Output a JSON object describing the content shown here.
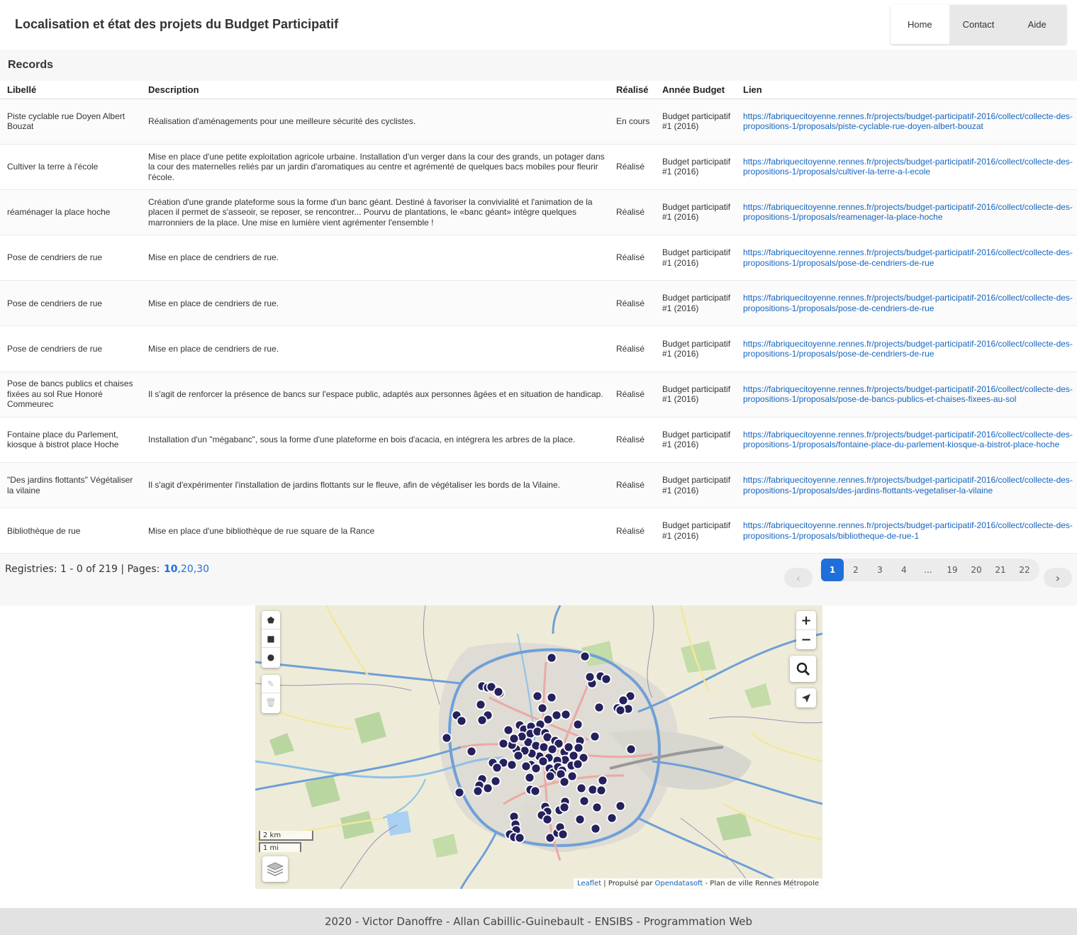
{
  "header": {
    "title": "Localisation et état des projets du Budget Participatif",
    "nav": [
      {
        "label": "Home",
        "active": true
      },
      {
        "label": "Contact",
        "active": false
      },
      {
        "label": "Aide",
        "active": false
      }
    ]
  },
  "records": {
    "title": "Records",
    "columns": [
      "Libellé",
      "Description",
      "Réalisé",
      "Année Budget",
      "Lien"
    ],
    "rows": [
      {
        "libelle": "Piste cyclable rue Doyen Albert Bouzat",
        "description": "Réalisation d'aménagements pour une meilleure sécurité des cyclistes.",
        "realise": "En cours",
        "annee": "Budget participatif #1 (2016)",
        "lien": "https://fabriquecitoyenne.rennes.fr/projects/budget-participatif-2016/collect/collecte-des-propositions-1/proposals/piste-cyclable-rue-doyen-albert-bouzat"
      },
      {
        "libelle": "Cultiver la terre à l'école",
        "description": "Mise en place d'une petite exploitation agricole urbaine. Installation d'un verger dans la cour des grands, un potager dans la cour des maternelles reliés par un jardin d'aromatiques au centre et agrémenté de quelques bacs mobiles pour fleurir l'école.",
        "realise": "Réalisé",
        "annee": "Budget participatif #1 (2016)",
        "lien": "https://fabriquecitoyenne.rennes.fr/projects/budget-participatif-2016/collect/collecte-des-propositions-1/proposals/cultiver-la-terre-a-l-ecole"
      },
      {
        "libelle": "réaménager la place hoche",
        "description": "Création d'une grande plateforme sous la forme d'un banc géant. Destiné à favoriser la convivialité et l'animation de la placen il permet de s'asseoir, se reposer, se rencontrer... Pourvu de plantations, le «banc géant» intègre quelques marronniers de la place. Une mise en lumière vient agrémenter l'ensemble !",
        "realise": "Réalisé",
        "annee": "Budget participatif #1 (2016)",
        "lien": "https://fabriquecitoyenne.rennes.fr/projects/budget-participatif-2016/collect/collecte-des-propositions-1/proposals/reamenager-la-place-hoche"
      },
      {
        "libelle": "Pose de cendriers de rue",
        "description": "Mise en place de cendriers de rue.",
        "realise": "Réalisé",
        "annee": "Budget participatif #1 (2016)",
        "lien": "https://fabriquecitoyenne.rennes.fr/projects/budget-participatif-2016/collect/collecte-des-propositions-1/proposals/pose-de-cendriers-de-rue"
      },
      {
        "libelle": "Pose de cendriers de rue",
        "description": "Mise en place de cendriers de rue.",
        "realise": "Réalisé",
        "annee": "Budget participatif #1 (2016)",
        "lien": "https://fabriquecitoyenne.rennes.fr/projects/budget-participatif-2016/collect/collecte-des-propositions-1/proposals/pose-de-cendriers-de-rue"
      },
      {
        "libelle": "Pose de cendriers de rue",
        "description": "Mise en place de cendriers de rue.",
        "realise": "Réalisé",
        "annee": "Budget participatif #1 (2016)",
        "lien": "https://fabriquecitoyenne.rennes.fr/projects/budget-participatif-2016/collect/collecte-des-propositions-1/proposals/pose-de-cendriers-de-rue"
      },
      {
        "libelle": "Pose de bancs publics et chaises fixées au sol Rue Honoré Commeurec",
        "description": "Il s'agit de renforcer la présence de bancs sur l'espace public, adaptés aux personnes âgées et en situation de handicap.",
        "realise": "Réalisé",
        "annee": "Budget participatif #1 (2016)",
        "lien": "https://fabriquecitoyenne.rennes.fr/projects/budget-participatif-2016/collect/collecte-des-propositions-1/proposals/pose-de-bancs-publics-et-chaises-fixees-au-sol"
      },
      {
        "libelle": "Fontaine place du Parlement, kiosque à bistrot place Hoche",
        "description": "Installation d'un \"mégabanc\", sous la forme d'une plateforme en bois d'acacia, en intégrera les arbres de la place.",
        "realise": "Réalisé",
        "annee": "Budget participatif #1 (2016)",
        "lien": "https://fabriquecitoyenne.rennes.fr/projects/budget-participatif-2016/collect/collecte-des-propositions-1/proposals/fontaine-place-du-parlement-kiosque-a-bistrot-place-hoche"
      },
      {
        "libelle": "\"Des jardins flottants\" Végétaliser la vilaine",
        "description": "Il s'agit d'expérimenter l'installation de jardins flottants sur le fleuve, afin de végétaliser les bords de la Vilaine.",
        "realise": "Réalisé",
        "annee": "Budget participatif #1 (2016)",
        "lien": "https://fabriquecitoyenne.rennes.fr/projects/budget-participatif-2016/collect/collecte-des-propositions-1/proposals/des-jardins-flottants-vegetaliser-la-vilaine"
      },
      {
        "libelle": "Bibliothèque de rue",
        "description": "Mise en place d'une bibliothèque de rue square de la Rance",
        "realise": "Réalisé",
        "annee": "Budget participatif #1 (2016)",
        "lien": "https://fabriquecitoyenne.rennes.fr/projects/budget-participatif-2016/collect/collecte-des-propositions-1/proposals/bibliotheque-de-rue-1"
      }
    ]
  },
  "pagination": {
    "info": "Registries: 1 - 0 of 219 | Pages:",
    "sizes": [
      "10",
      ",20",
      ",30"
    ],
    "selected_size": "10",
    "prev": "‹",
    "next": "›",
    "pages": [
      "1",
      "2",
      "3",
      "4",
      "...",
      "19",
      "20",
      "21",
      "22"
    ],
    "current": "1"
  },
  "map": {
    "zoom_in": "+",
    "zoom_out": "−",
    "scale_km": "2 km",
    "scale_mi": "1 mi",
    "attribution_leaflet": "Leaflet",
    "attribution_mid": " | Propulsé par ",
    "attribution_ods": "Opendatasoft",
    "attribution_end": " - Plan de ville Rennes Métropole",
    "marker_color": "#24215c",
    "icons": [
      "polygon-icon",
      "rectangle-icon",
      "circle-icon",
      "edit-icon",
      "trash-icon",
      "search-icon",
      "locate-icon",
      "layers-icon"
    ]
  },
  "footer": {
    "text": "2020 - Victor Danoffre - Allan Cabillic-Guinebault - ENSIBS - Programmation Web"
  }
}
